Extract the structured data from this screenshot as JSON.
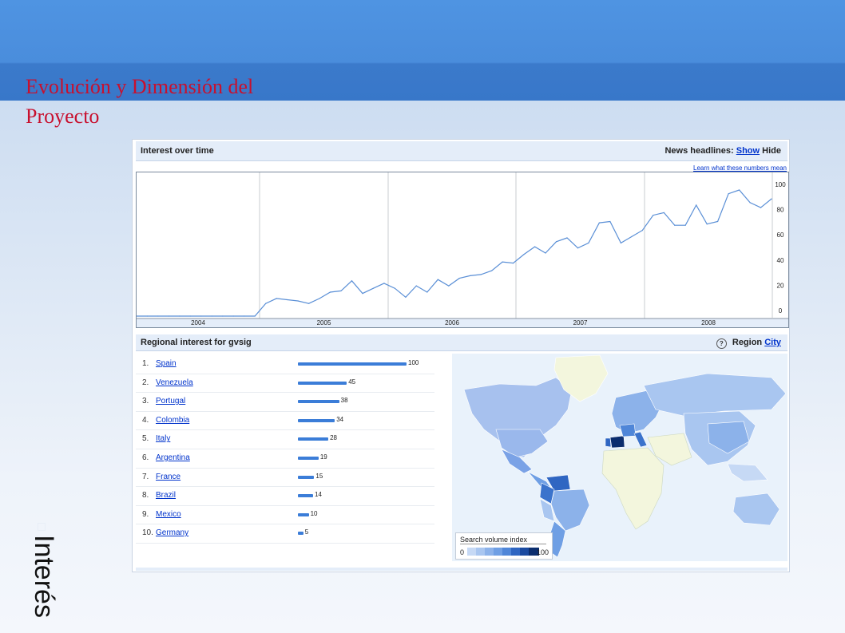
{
  "slide": {
    "title": "Evolución y Dimensión del Proyecto",
    "side_text": "Interés"
  },
  "interest": {
    "header_title": "Interest over time",
    "news_label": "News headlines:",
    "news_show": "Show",
    "news_hide": "Hide",
    "learn_link": "Learn what these numbers mean"
  },
  "regional": {
    "header_title": "Regional interest  for gvsig",
    "region_label": "Region",
    "city_link": "City",
    "items": [
      {
        "rank": "1.",
        "name": "Spain",
        "value": 100
      },
      {
        "rank": "2.",
        "name": "Venezuela",
        "value": 45
      },
      {
        "rank": "3.",
        "name": "Portugal",
        "value": 38
      },
      {
        "rank": "4.",
        "name": "Colombia",
        "value": 34
      },
      {
        "rank": "5.",
        "name": "Italy",
        "value": 28
      },
      {
        "rank": "6.",
        "name": "Argentina",
        "value": 19
      },
      {
        "rank": "7.",
        "name": "France",
        "value": 15
      },
      {
        "rank": "8.",
        "name": "Brazil",
        "value": 14
      },
      {
        "rank": "9.",
        "name": "Mexico",
        "value": 10
      },
      {
        "rank": "10.",
        "name": "Germany",
        "value": 5
      }
    ],
    "legend": {
      "title": "Search volume index",
      "min": "0",
      "max": "100",
      "colors": [
        "#c6d9f5",
        "#a9c6f0",
        "#8cb2ea",
        "#6f9fe4",
        "#4f86d8",
        "#2f66c2",
        "#1a4aa0",
        "#0b2d6e"
      ]
    }
  },
  "chart_data": {
    "type": "line",
    "x": [
      2003.5,
      2003.6,
      2003.7,
      2003.8,
      2003.9,
      2004.0,
      2004.1,
      2004.2,
      2004.3,
      2004.4,
      2004.5,
      2004.6,
      2004.7,
      2004.8,
      2004.9,
      2005.0,
      2005.1,
      2005.2,
      2005.3,
      2005.4,
      2005.5,
      2005.6,
      2005.7,
      2005.8,
      2005.9,
      2006.0,
      2006.1,
      2006.2,
      2006.3,
      2006.4,
      2006.5,
      2006.6,
      2006.7,
      2006.8,
      2006.9,
      2007.0,
      2007.1,
      2007.2,
      2007.3,
      2007.4,
      2007.5,
      2007.6,
      2007.7,
      2007.8,
      2007.9,
      2008.0,
      2008.1,
      2008.2,
      2008.3,
      2008.4,
      2008.5,
      2008.6,
      2008.7,
      2008.8,
      2008.9
    ],
    "series": [
      {
        "values": [
          0,
          0,
          0,
          0,
          0,
          0,
          0,
          0,
          0,
          0,
          0,
          0,
          10,
          14,
          13,
          12,
          10,
          14,
          19,
          20,
          28,
          18,
          22,
          26,
          22,
          15,
          24,
          19,
          29,
          24,
          30,
          32,
          33,
          36,
          43,
          42,
          49,
          55,
          50,
          59,
          62,
          54,
          58,
          74,
          75,
          58,
          63,
          68,
          80,
          82,
          72,
          72,
          88,
          73,
          75,
          97,
          100,
          90,
          86,
          93
        ]
      }
    ],
    "x_ticks": [
      "2004",
      "2005",
      "2006",
      "2007",
      "2008"
    ],
    "y_ticks": [
      0,
      20,
      40,
      60,
      80,
      100
    ],
    "ylim": [
      0,
      100
    ],
    "grid": true
  }
}
